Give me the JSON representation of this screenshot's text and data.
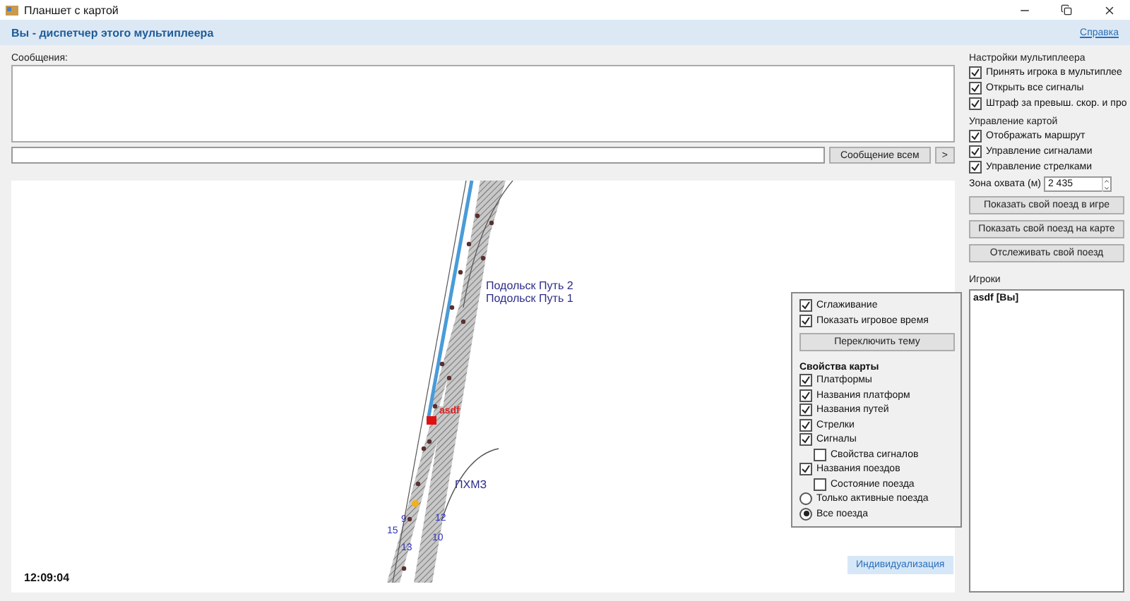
{
  "window": {
    "title": "Планшет с картой"
  },
  "banner": {
    "text": "Вы - диспетчер этого мультиплеера",
    "help_link": "Справка"
  },
  "messages": {
    "label": "Сообщения:",
    "send_button": "Сообщение всем",
    "more_button": ">"
  },
  "map": {
    "labels": [
      {
        "text": "Подольск Путь 2",
        "kind": "track"
      },
      {
        "text": "Подольск Путь 1",
        "kind": "track"
      },
      {
        "text": "asdf",
        "kind": "train"
      },
      {
        "text": "ПХМЗ",
        "kind": "track"
      },
      {
        "text": "9",
        "kind": "number"
      },
      {
        "text": "15",
        "kind": "number"
      },
      {
        "text": "13",
        "kind": "number"
      },
      {
        "text": "12",
        "kind": "number"
      },
      {
        "text": "10",
        "kind": "number"
      }
    ],
    "time": "12:09:04"
  },
  "map_options": {
    "items": [
      {
        "kind": "checkbox",
        "label": "Сглаживание",
        "checked": true
      },
      {
        "kind": "checkbox",
        "label": "Показать игровое время",
        "checked": true
      }
    ],
    "theme_button": "Переключить тему",
    "properties_title": "Свойства карты",
    "properties": [
      {
        "kind": "checkbox",
        "label": "Платформы",
        "checked": true
      },
      {
        "kind": "checkbox",
        "label": "Названия платформ",
        "checked": true
      },
      {
        "kind": "checkbox",
        "label": "Названия путей",
        "checked": true
      },
      {
        "kind": "checkbox",
        "label": "Стрелки",
        "checked": true
      },
      {
        "kind": "checkbox",
        "label": "Сигналы",
        "checked": true,
        "children": [
          {
            "kind": "checkbox",
            "label": "Свойства сигналов",
            "checked": false
          }
        ]
      },
      {
        "kind": "checkbox",
        "label": "Названия поездов",
        "checked": true,
        "children": [
          {
            "kind": "checkbox",
            "label": "Состояние поезда",
            "checked": false
          }
        ]
      },
      {
        "kind": "radio",
        "label": "Только активные поезда",
        "selected": false
      },
      {
        "kind": "radio",
        "label": "Все поезда",
        "selected": true
      }
    ],
    "customize_button": "Индивидуализация"
  },
  "multiplayer": {
    "title": "Настройки мультиплеера",
    "items": [
      {
        "kind": "checkbox",
        "label": "Принять игрока в мультиплее",
        "checked": true
      },
      {
        "kind": "checkbox",
        "label": "Открыть все сигналы",
        "checked": true
      },
      {
        "kind": "checkbox",
        "label": "Штраф за превыш. скор. и про",
        "checked": true
      }
    ]
  },
  "map_control": {
    "title": "Управление картой",
    "items": [
      {
        "kind": "checkbox",
        "label": "Отображать маршрут",
        "checked": true
      },
      {
        "kind": "checkbox",
        "label": "Управление сигналами",
        "checked": true
      },
      {
        "kind": "checkbox",
        "label": "Управление стрелками",
        "checked": true
      }
    ],
    "zone_label": "Зона охвата (м)",
    "zone_value": "2 435",
    "buttons": [
      "Показать свой поезд в игре",
      "Показать свой поезд на карте",
      "Отслеживать свой поезд"
    ]
  },
  "players": {
    "title": "Игроки",
    "items": [
      {
        "name": "asdf [Вы]"
      }
    ]
  }
}
